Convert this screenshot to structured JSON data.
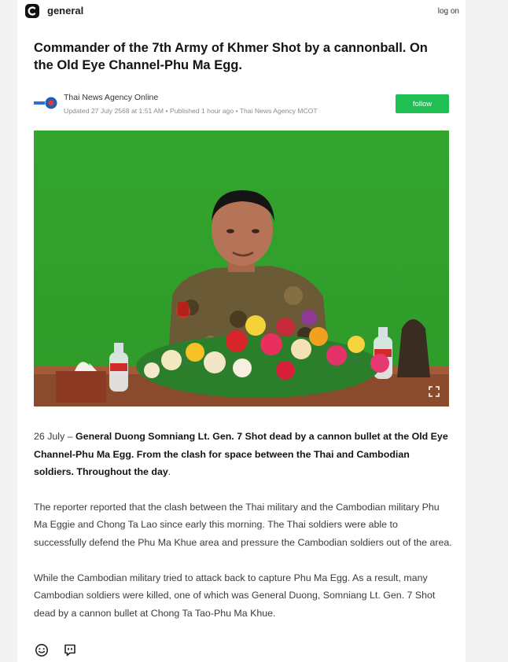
{
  "app": {
    "name": "general",
    "login_label": "log on"
  },
  "article": {
    "headline": "Commander of the 7th Army of Khmer Shot by a cannonball. On the Old Eye Channel-Phu Ma Egg.",
    "source_name": "Thai News Agency Online",
    "meta": "Updated 27 July 2568 at 1:51 AM • Published 1 hour ago • Thai News Agency MCOT",
    "follow_label": "follow",
    "lead_date": "26 July – ",
    "lead_bold": "General Duong Somniang Lt. Gen. 7 Shot dead by a cannon bullet at the Old Eye Channel-Phu Ma Egg. From the clash for space between the Thai and Cambodian soldiers. Throughout the day",
    "lead_end": ".",
    "paragraph_2": "The reporter reported that the clash between the Thai military and the Cambodian military Phu Ma Eggie and Chong Ta Lao since early this morning. The Thai soldiers were able to successfully defend the Phu Ma Khue area and pressure the Cambodian soldiers out of the area.",
    "paragraph_3": "While the Cambodian military tried to attack back to capture Phu Ma Egg. As a result, many Cambodian soldiers were killed, one of which was General Duong, Somniang Lt. Gen. 7 Shot dead by a cannon bullet at Chong Ta Tao-Phu Ma Khue."
  },
  "image": {
    "description_icon": "photo-of-officer-at-desk"
  },
  "icons": {
    "logo": "app-logo-icon",
    "reaction": "smiley-icon",
    "comment": "comment-icon",
    "expand": "expand-icon"
  },
  "colors": {
    "accent": "#1fbf54",
    "background_green": "#35a52e"
  }
}
